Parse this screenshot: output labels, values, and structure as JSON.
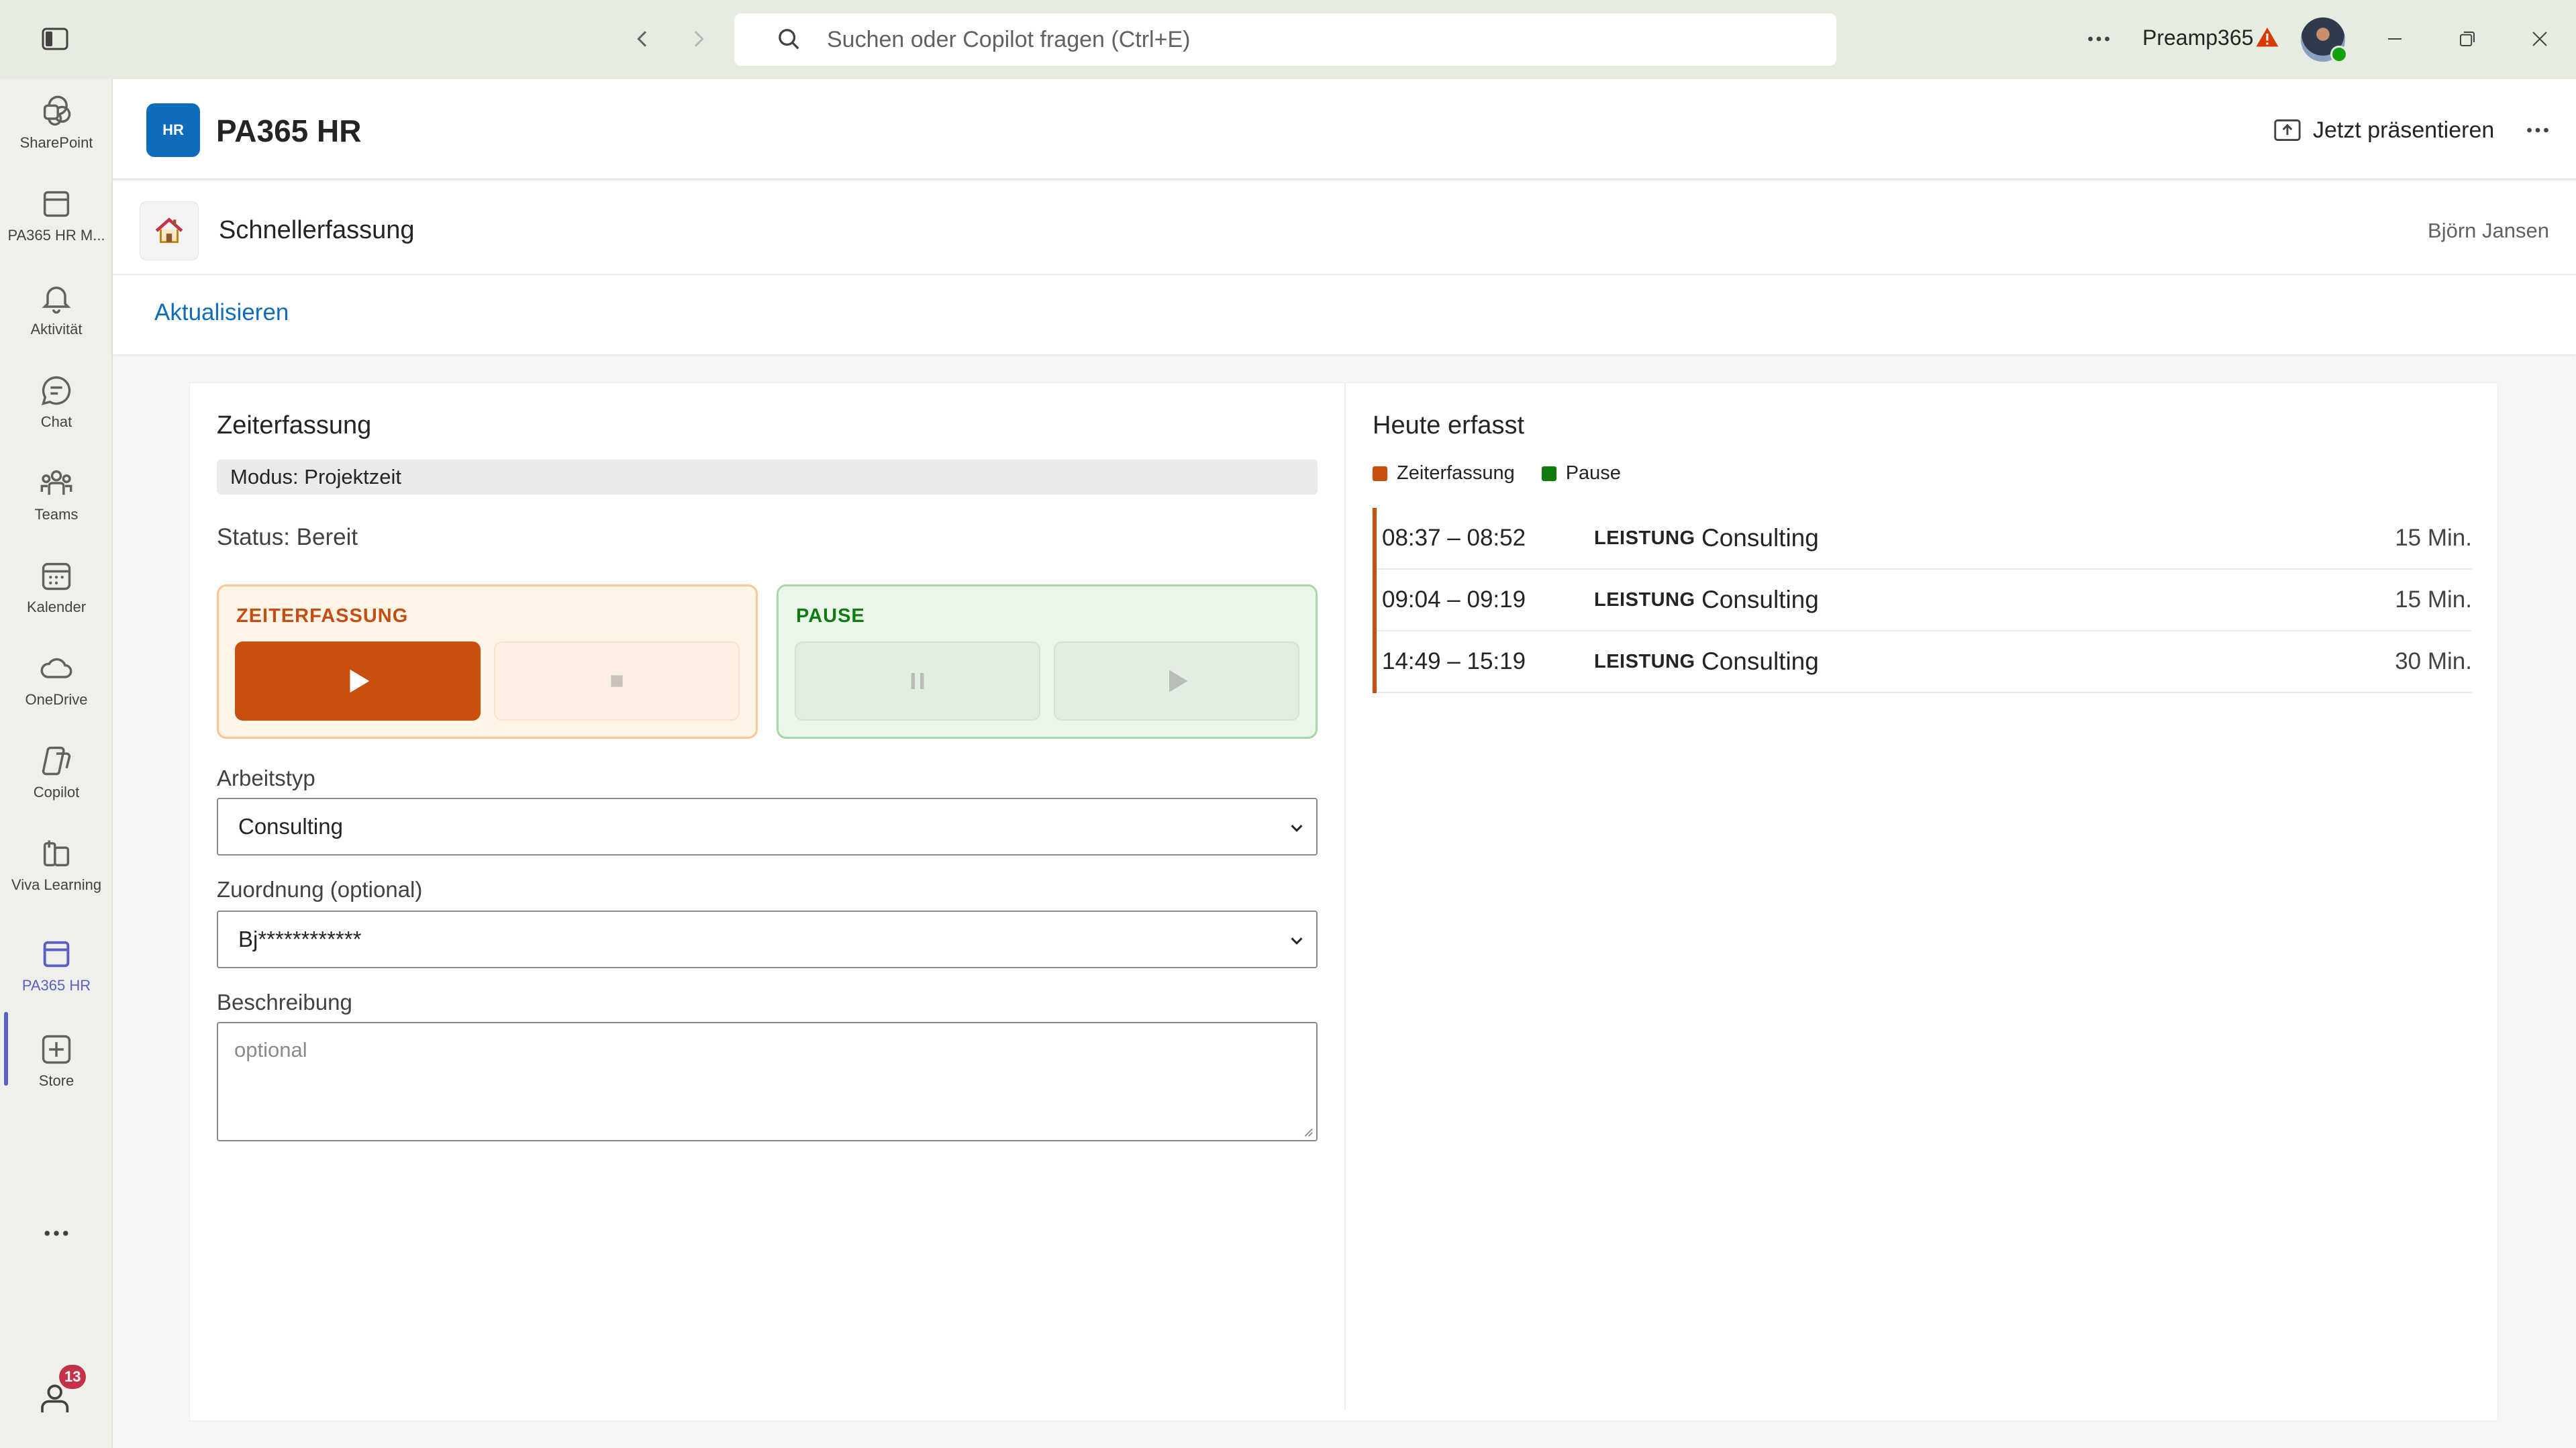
{
  "titlebar": {
    "search_placeholder": "Suchen oder Copilot fragen (Ctrl+E)",
    "tenant": "Preamp365"
  },
  "rail": {
    "items": [
      {
        "label": "SharePoint",
        "icon": "sharepoint-icon"
      },
      {
        "label": "PA365 HR M...",
        "icon": "app-icon"
      },
      {
        "label": "Aktivität",
        "icon": "bell-icon"
      },
      {
        "label": "Chat",
        "icon": "chat-icon"
      },
      {
        "label": "Teams",
        "icon": "teams-icon"
      },
      {
        "label": "Kalender",
        "icon": "calendar-icon"
      },
      {
        "label": "OneDrive",
        "icon": "cloud-icon"
      },
      {
        "label": "Copilot",
        "icon": "copilot-icon"
      },
      {
        "label": "Viva Learning",
        "icon": "book-icon"
      },
      {
        "label": "PA365 HR",
        "icon": "app-icon"
      },
      {
        "label": "Store",
        "icon": "plus-box-icon"
      }
    ],
    "active_index": 9,
    "notification_count": "13"
  },
  "app": {
    "logo_text": "HR",
    "title": "PA365 HR",
    "present_label": "Jetzt präsentieren"
  },
  "page": {
    "name": "Schnellerfassung",
    "user": "Björn Jansen",
    "refresh_label": "Aktualisieren"
  },
  "left": {
    "title": "Zeiterfassung",
    "mode": "Modus: Projektzeit",
    "status": "Status: Bereit",
    "time_group_label": "ZEITERFASSUNG",
    "pause_group_label": "PAUSE",
    "worktype_label": "Arbeitstyp",
    "worktype_value": "Consulting",
    "assignment_label": "Zuordnung (optional)",
    "assignment_value": "Bj************",
    "description_label": "Beschreibung",
    "description_placeholder": "optional"
  },
  "right": {
    "title": "Heute erfasst",
    "legend": [
      {
        "label": "Zeiterfassung",
        "color": "#c94f0f"
      },
      {
        "label": "Pause",
        "color": "#107c10"
      }
    ],
    "entries": [
      {
        "time": "08:37 – 08:52",
        "tag": "LEISTUNG",
        "type": "Consulting",
        "duration": "15 Min."
      },
      {
        "time": "09:04 – 09:19",
        "tag": "LEISTUNG",
        "type": "Consulting",
        "duration": "15 Min."
      },
      {
        "time": "14:49 – 15:19",
        "tag": "LEISTUNG",
        "type": "Consulting",
        "duration": "30 Min."
      }
    ]
  },
  "colors": {
    "accent": "#0f6cbd",
    "teams_purple": "#5b5fc7",
    "time_orange": "#c94f0f",
    "pause_green": "#107c10"
  }
}
